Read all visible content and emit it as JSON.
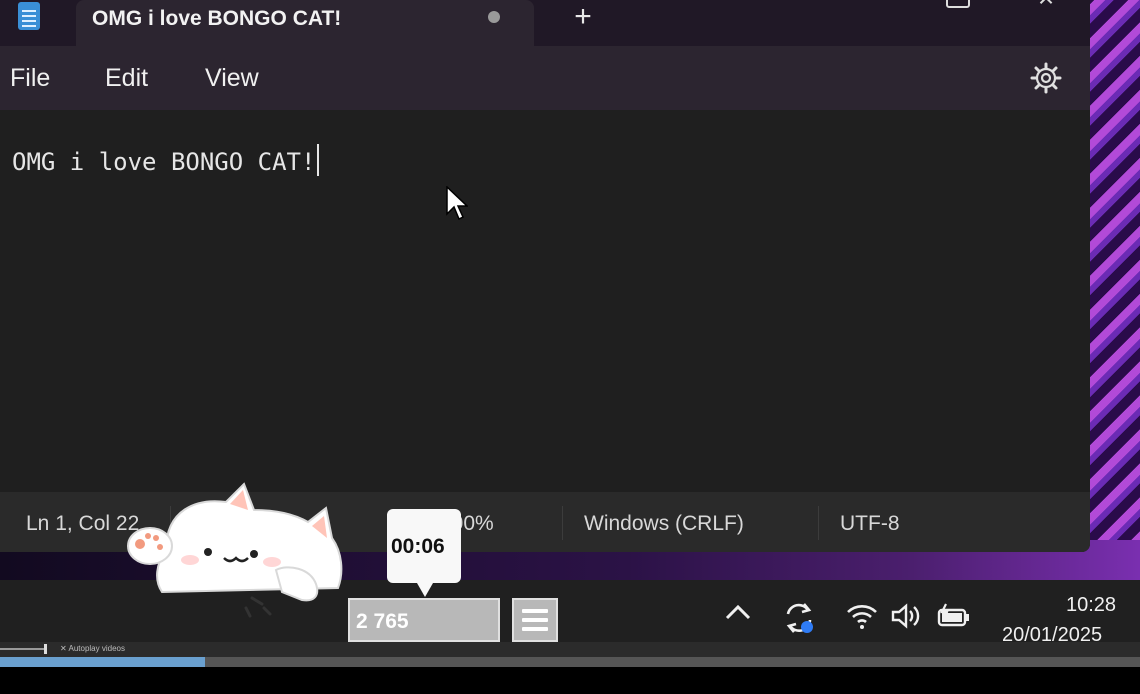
{
  "window": {
    "tab_title": "OMG i love BONGO CAT!",
    "new_tab_glyph": "+",
    "close_glyph": "×"
  },
  "menu": {
    "file": "File",
    "edit": "Edit",
    "view": "View"
  },
  "editor": {
    "content": "OMG i love BONGO CAT!"
  },
  "status": {
    "position": "Ln 1, Col 22",
    "zoom": "100%",
    "line_ending": "Windows (CRLF)",
    "encoding": "UTF-8"
  },
  "overlay": {
    "timer": "00:06",
    "counter": "2 765"
  },
  "taskbar": {
    "chevron_glyph": "^",
    "time": "10:28",
    "date": "20/01/2025"
  },
  "video": {
    "autoplay_label": "Autoplay videos",
    "progress_fraction": 0.18
  },
  "colors": {
    "notepad_bg": "#1f1f1f",
    "titlebar": "#2c2530",
    "accent_purple": "#b24ad8",
    "progress": "#6aa0cf"
  }
}
